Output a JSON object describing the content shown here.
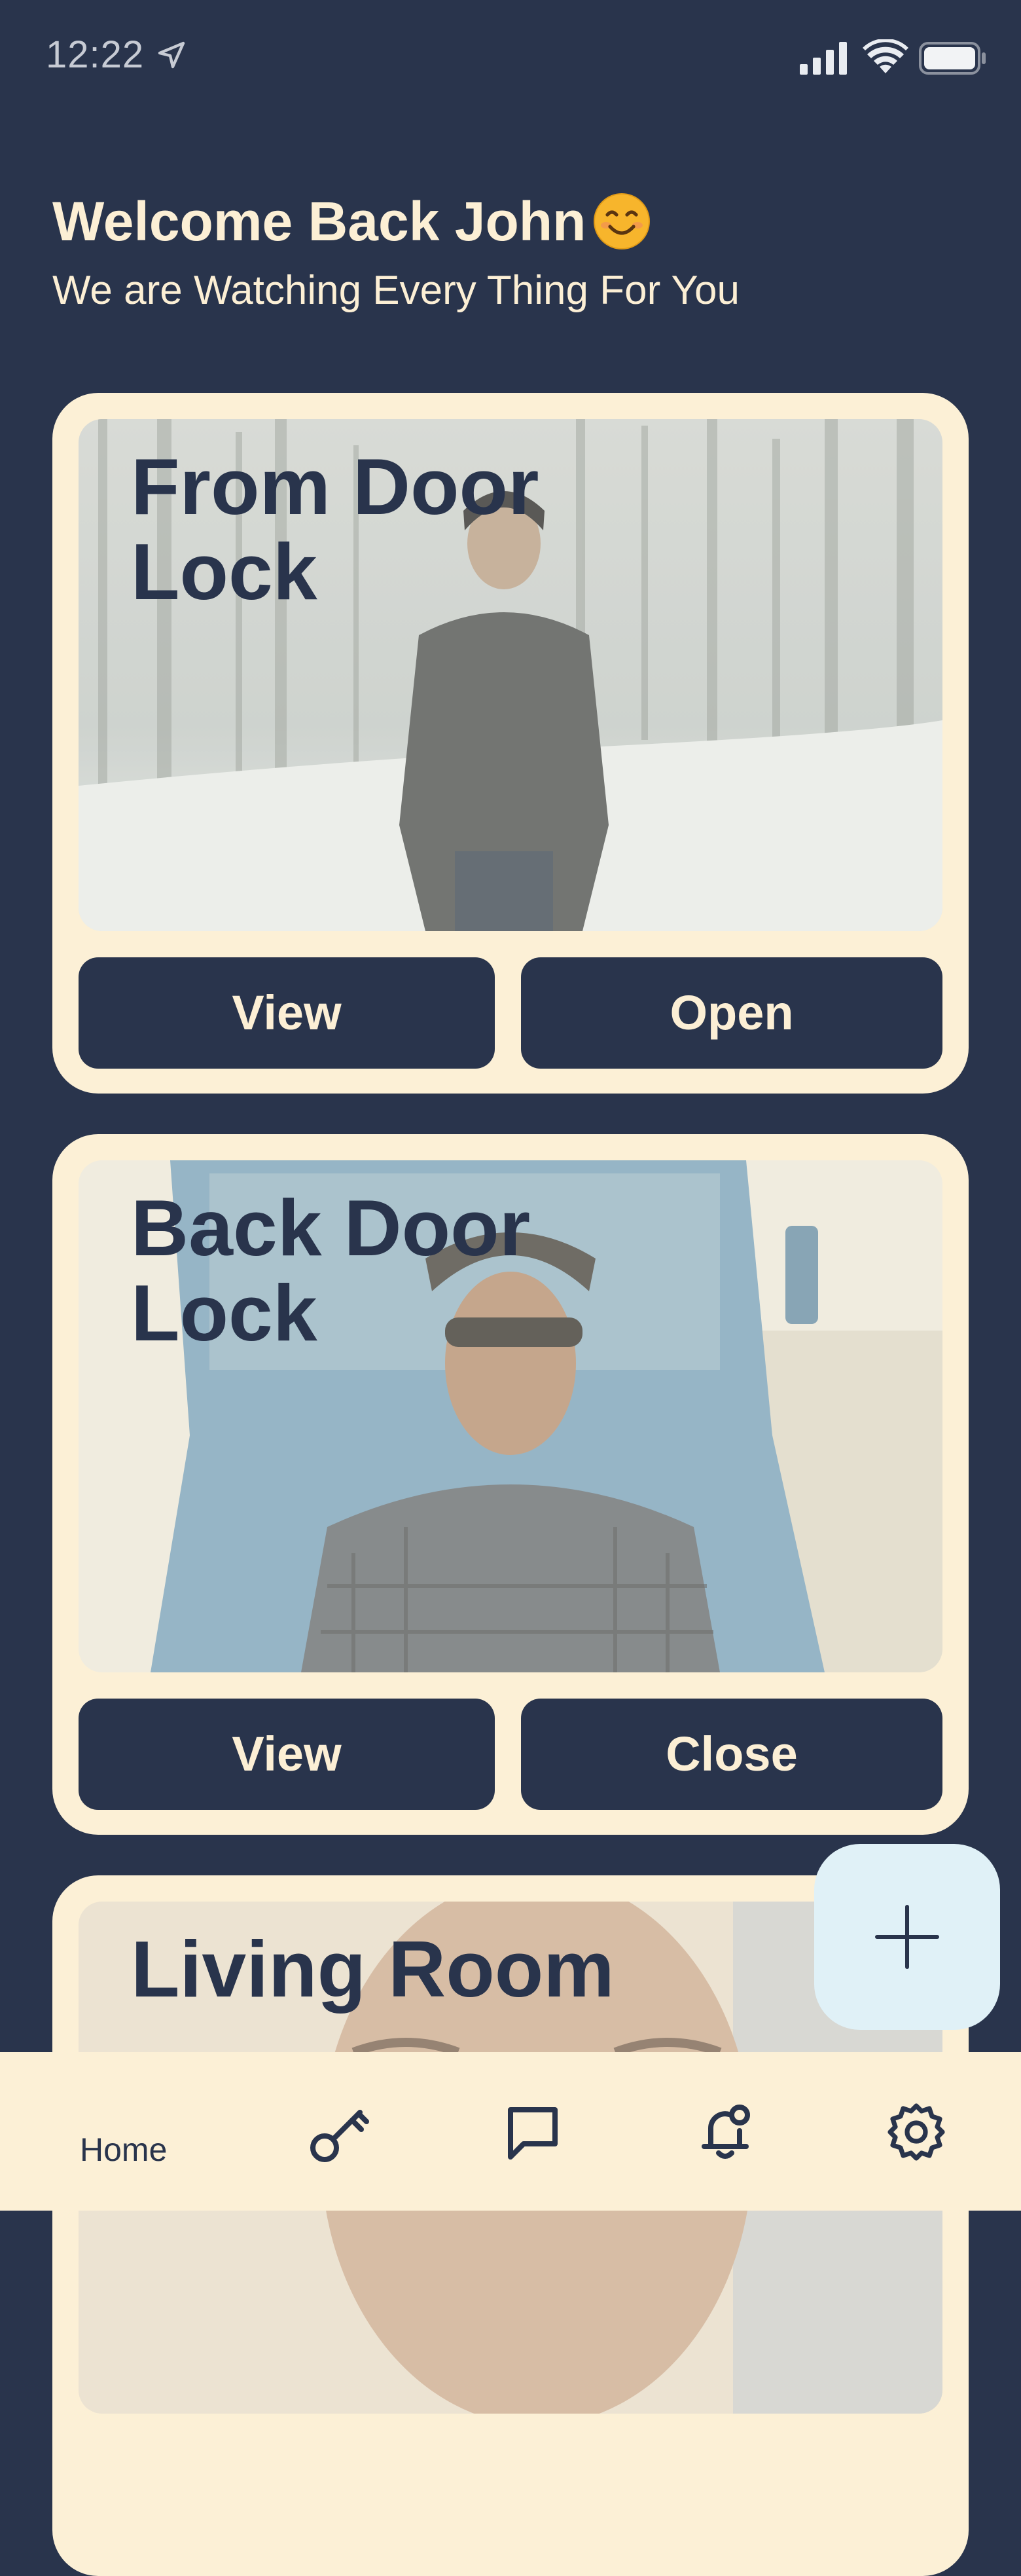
{
  "status_bar": {
    "time": "12:22",
    "icons": [
      "location-arrow-icon",
      "cellular-signal-icon",
      "wifi-icon",
      "battery-icon"
    ]
  },
  "header": {
    "title": "Welcome Back John",
    "emoji_icon": "smiling-face-icon",
    "subtitle": "We are Watching Every Thing For You"
  },
  "cards": [
    {
      "title": "From Door Lock",
      "view_label": "View",
      "action_label": "Open"
    },
    {
      "title": "Back Door Lock",
      "view_label": "View",
      "action_label": "Close"
    },
    {
      "title": "Living Room"
    }
  ],
  "fab": {
    "icon": "plus-icon"
  },
  "bottom_nav": {
    "home_label": "Home",
    "icons": [
      "key-icon",
      "chat-icon",
      "bell-icon",
      "gear-icon"
    ]
  },
  "colors": {
    "background": "#29344c",
    "card": "#fcf0d6",
    "button": "#29344c",
    "button_text": "#fcefd5",
    "fab": "#e0f1f7"
  }
}
